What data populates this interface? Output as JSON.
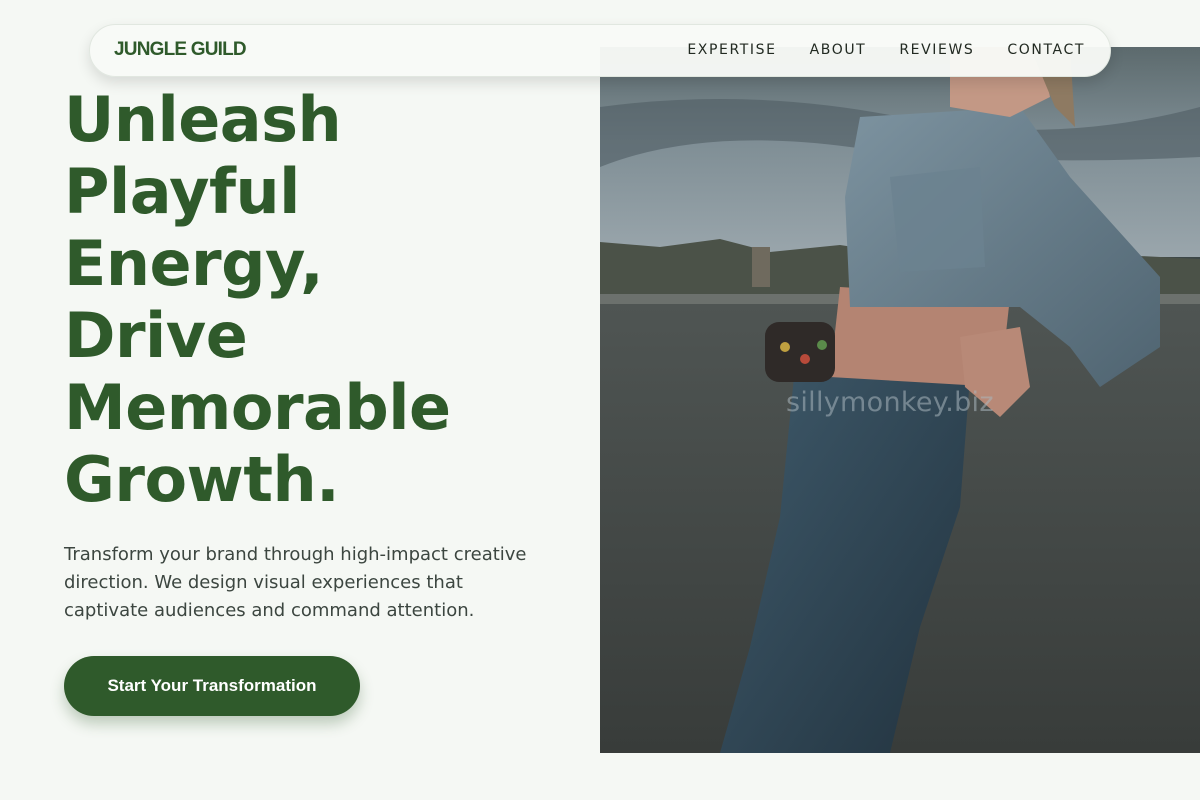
{
  "brand": {
    "logo_text": "JUNGLE GUILD",
    "accent_color": "#2f5a2b"
  },
  "nav": {
    "links": [
      {
        "label": "EXPERTISE"
      },
      {
        "label": "ABOUT"
      },
      {
        "label": "REVIEWS"
      },
      {
        "label": "CONTACT"
      }
    ]
  },
  "hero": {
    "headline_lines": [
      "Unleash",
      "Playful",
      "Energy,",
      "Drive",
      "Memorable",
      "Growth."
    ],
    "subtext": "Transform your brand through high-impact creative direction. We design visual experiences that captivate audiences and command attention.",
    "cta_label": "Start Your Transformation",
    "image": {
      "description_icon": "photo-model-denim-jacket",
      "watermark": "sillymonkey.biz"
    }
  }
}
